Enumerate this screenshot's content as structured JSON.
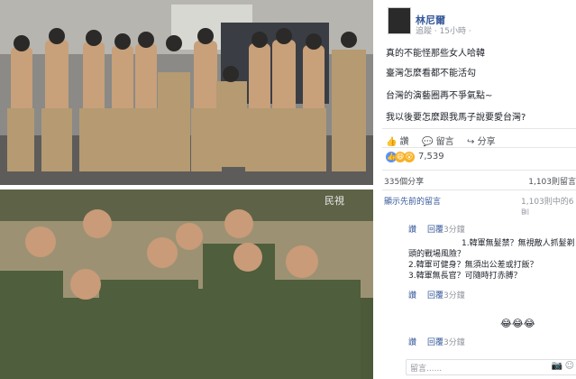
{
  "post": {
    "author": "林尼爾",
    "meta": "追蹤 · 15小時 ·",
    "lines": [
      "真的不能怪那些女人哈韓",
      "臺灣怎麼看都不能活勾",
      "台灣的演藝圈再不爭氣點~",
      "我以後要怎麼跟我馬子說要愛台灣?"
    ]
  },
  "actions": {
    "like": "讚",
    "comment": "留言",
    "share": "分享"
  },
  "reactions": {
    "count": "7,539"
  },
  "stats": {
    "shares": "335個分享",
    "comments_count": "1,103則留言"
  },
  "comments": {
    "view_previous": "顯示先前的留言",
    "count_right": "1,103則中的6則",
    "reply1": {
      "like": "讚",
      "reply": "回覆",
      "time": "3分鐘"
    },
    "reply2": {
      "line1": "1.韓軍無髮禁？無視敵人抓髮剃",
      "line2": "頭的戰場風險？",
      "line3": "2.韓軍可健身？無須出公差或打飯？",
      "line4": "3.韓軍無長官？可隨時打赤膊？",
      "like": "讚",
      "reply": "回覆",
      "time": "3分鐘"
    },
    "reply3": {
      "emojis": "😂😂😂",
      "like": "讚",
      "reply": "回覆",
      "time": "3分鐘"
    },
    "reply_placeholder": "留言......"
  },
  "colors": {
    "link": "#365899",
    "text": "#1d2129",
    "muted": "#90949c"
  },
  "icons": {
    "like": "thumb-up-icon",
    "comment": "speech-bubble-icon",
    "share": "share-arrow-icon"
  },
  "watermark": "民視"
}
